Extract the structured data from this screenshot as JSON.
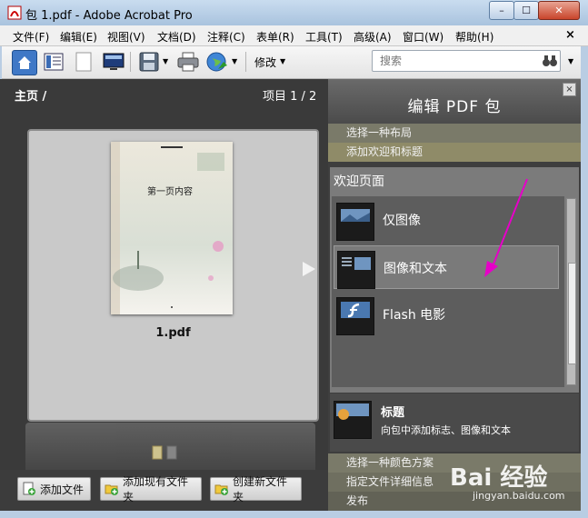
{
  "window": {
    "title": "包 1.pdf - Adobe Acrobat Pro",
    "minimize": "–",
    "maximize": "☐",
    "close": "✕"
  },
  "menu": {
    "items": [
      "文件(F)",
      "编辑(E)",
      "视图(V)",
      "文档(D)",
      "注释(C)",
      "表单(R)",
      "工具(T)",
      "高级(A)",
      "窗口(W)",
      "帮助(H)"
    ],
    "close": "×"
  },
  "toolbar": {
    "modify_label": "修改",
    "search_placeholder": "搜索"
  },
  "left_pane": {
    "home": "主页 /",
    "item_count": "项目 1 / 2",
    "doc": {
      "filename": "1.pdf",
      "page_text": "第一页内容"
    },
    "buttons": {
      "add_file": "添加文件",
      "add_existing_folder": "添加现有文件夹",
      "create_new_folder": "创建新文件夹"
    }
  },
  "right_pane": {
    "title": "编辑 PDF 包",
    "close": "×",
    "steps": {
      "layout": "选择一种布局",
      "welcome": "添加欢迎和标题",
      "color": "选择一种颜色方案",
      "details": "指定文件详细信息",
      "publish": "发布"
    },
    "welcome_page": {
      "heading": "欢迎页面",
      "options": [
        "仅图像",
        "图像和文本",
        "Flash 电影"
      ],
      "selected": "图像和文本"
    },
    "title_section": {
      "name": "标题",
      "description": "向包中添加标志、图像和文本"
    }
  },
  "watermark": {
    "logo": "Bai 经验",
    "url": "jingyan.baidu.com"
  },
  "colors": {
    "annotation_arrow": "#e600c8",
    "accent": "#8f8b68"
  }
}
